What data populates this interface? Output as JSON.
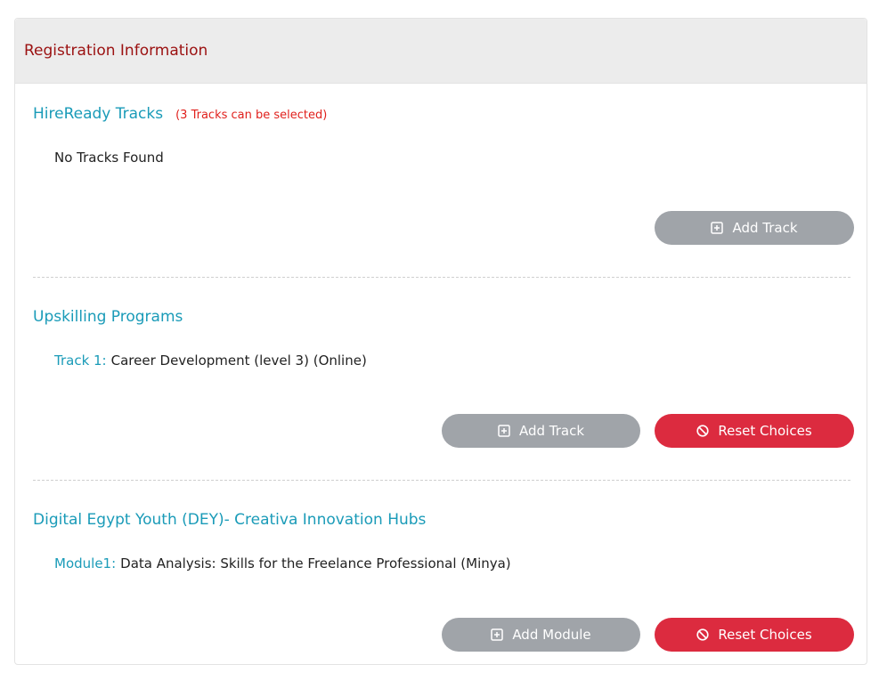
{
  "header": {
    "title": "Registration Information"
  },
  "sections": [
    {
      "title": "HireReady Tracks",
      "note": "(3 Tracks can be selected)",
      "line_label": "",
      "line_text": "No Tracks Found",
      "add_label": "Add Track",
      "reset_label": ""
    },
    {
      "title": "Upskilling Programs",
      "note": "",
      "line_label": "Track 1:",
      "line_text": "Career Development (level 3) (Online)",
      "add_label": "Add Track",
      "reset_label": "Reset Choices"
    },
    {
      "title": "Digital Egypt Youth (DEY)- Creativa Innovation Hubs",
      "note": "",
      "line_label": "Module1:",
      "line_text": "Data Analysis: Skills for the Freelance Professional (Minya)",
      "add_label": "Add Module",
      "reset_label": "Reset Choices"
    }
  ],
  "colors": {
    "header_text": "#9b1111",
    "section_title": "#1a9bb8",
    "note": "#e0201c",
    "button_gray": "#a0a4a9",
    "button_red": "#dc2b3f"
  },
  "icons": {
    "add": "plus-square-icon",
    "reset": "ban-icon"
  }
}
